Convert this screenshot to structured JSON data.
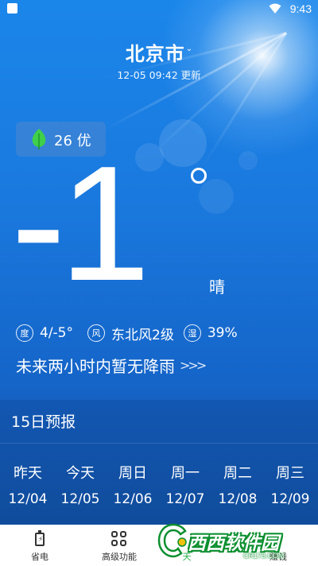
{
  "status_bar": {
    "time": "9:43"
  },
  "header": {
    "city": "北京市",
    "chevron": "⌄",
    "update_time": "12-05 09:42 更新"
  },
  "aqi": {
    "value": "26",
    "level": "优",
    "leaf_color": "#3fcf4a"
  },
  "current": {
    "temperature": "-1",
    "condition": "晴"
  },
  "details": {
    "humidity_label": "度",
    "temp_range": "4/-5°",
    "wind_label": "风",
    "wind": "东北风2级",
    "humidity_icon_label": "湿",
    "humidity": "39%"
  },
  "rain_forecast": {
    "text": "未来两小时内暂无降雨",
    "arrows": ">>>"
  },
  "forecast": {
    "title": "15日预报",
    "days": [
      {
        "name": "昨天",
        "date": "12/04"
      },
      {
        "name": "今天",
        "date": "12/05"
      },
      {
        "name": "周日",
        "date": "12/06"
      },
      {
        "name": "周一",
        "date": "12/07"
      },
      {
        "name": "周二",
        "date": "12/08"
      },
      {
        "name": "周三",
        "date": "12/09"
      }
    ]
  },
  "bottom_nav": {
    "items": [
      {
        "label": "省电",
        "icon": "battery-icon"
      },
      {
        "label": "高级功能",
        "icon": "grid-icon"
      },
      {
        "label": "天",
        "icon": "weather-icon"
      },
      {
        "label": "赚钱",
        "icon": "money-icon"
      }
    ]
  },
  "watermark": {
    "title": "西西软件园",
    "sub": "CR173.COM"
  },
  "colors": {
    "accent_green": "#2bb24c",
    "sky_blue": "#1a7fe0"
  }
}
